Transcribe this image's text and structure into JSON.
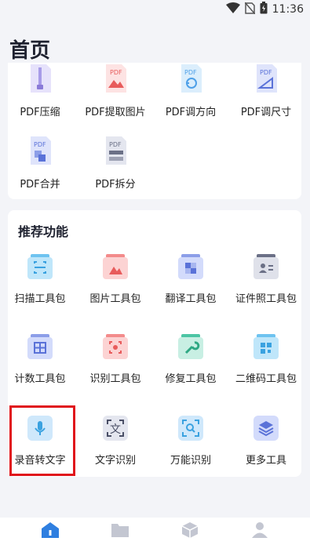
{
  "status": {
    "time": "11:36"
  },
  "page_title": "首页",
  "pdf_tools": [
    {
      "label": "PDF压缩",
      "icon": "pdf-compress-icon"
    },
    {
      "label": "PDF提取图片",
      "icon": "pdf-extract-image-icon"
    },
    {
      "label": "PDF调方向",
      "icon": "pdf-rotate-icon"
    },
    {
      "label": "PDF调尺寸",
      "icon": "pdf-resize-icon"
    },
    {
      "label": "PDF合并",
      "icon": "pdf-merge-icon"
    },
    {
      "label": "PDF拆分",
      "icon": "pdf-split-icon"
    }
  ],
  "recommend": {
    "title": "推荐功能",
    "items": [
      {
        "label": "扫描工具包",
        "icon": "scan-toolbox-icon"
      },
      {
        "label": "图片工具包",
        "icon": "image-toolbox-icon"
      },
      {
        "label": "翻译工具包",
        "icon": "translate-toolbox-icon"
      },
      {
        "label": "证件照工具包",
        "icon": "id-photo-toolbox-icon"
      },
      {
        "label": "计数工具包",
        "icon": "count-toolbox-icon"
      },
      {
        "label": "识别工具包",
        "icon": "recognize-toolbox-icon"
      },
      {
        "label": "修复工具包",
        "icon": "repair-toolbox-icon"
      },
      {
        "label": "二维码工具包",
        "icon": "qrcode-toolbox-icon"
      },
      {
        "label": "录音转文字",
        "icon": "microphone-icon"
      },
      {
        "label": "文字识别",
        "icon": "text-recognize-icon"
      },
      {
        "label": "万能识别",
        "icon": "universal-recognize-icon"
      },
      {
        "label": "更多工具",
        "icon": "more-tools-icon"
      }
    ]
  },
  "bottom_nav": [
    "home-icon",
    "folder-icon",
    "cube-icon",
    "profile-icon"
  ]
}
